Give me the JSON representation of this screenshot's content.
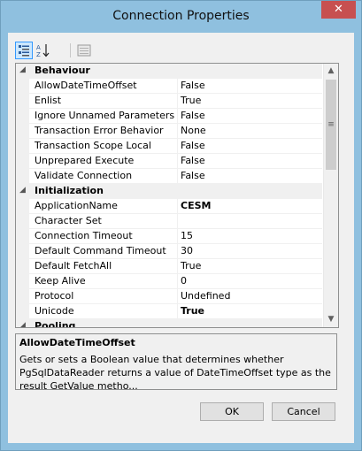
{
  "window": {
    "title": "Connection Properties",
    "close_glyph": "✕"
  },
  "toolbar": {
    "categorized_icon": "categorized-icon",
    "alphabetical_icon": "alphabetical-sort-icon",
    "property_pages_icon": "property-pages-icon"
  },
  "grid": {
    "categories": [
      {
        "label": "Behaviour",
        "props": [
          {
            "name": "AllowDateTimeOffset",
            "value": "False"
          },
          {
            "name": "Enlist",
            "value": "True"
          },
          {
            "name": "Ignore Unnamed Parameters",
            "value": "False"
          },
          {
            "name": "Transaction Error Behavior",
            "value": "None"
          },
          {
            "name": "Transaction Scope Local",
            "value": "False"
          },
          {
            "name": "Unprepared Execute",
            "value": "False"
          },
          {
            "name": "Validate Connection",
            "value": "False"
          }
        ]
      },
      {
        "label": "Initialization",
        "props": [
          {
            "name": "ApplicationName",
            "value": "CESM"
          },
          {
            "name": "Character Set",
            "value": ""
          },
          {
            "name": "Connection Timeout",
            "value": "15"
          },
          {
            "name": "Default Command Timeout",
            "value": "30"
          },
          {
            "name": "Default FetchAll",
            "value": "True"
          },
          {
            "name": "Keep Alive",
            "value": "0"
          },
          {
            "name": "Protocol",
            "value": "Undefined"
          },
          {
            "name": "Unicode",
            "value": "True"
          }
        ]
      },
      {
        "label": "Pooling",
        "props": []
      }
    ]
  },
  "help": {
    "title": "AllowDateTimeOffset",
    "description": "Gets or sets a Boolean value that determines whether PgSqlDataReader returns a value of DateTimeOffset type as the result GetValue metho..."
  },
  "buttons": {
    "ok": "OK",
    "cancel": "Cancel"
  }
}
